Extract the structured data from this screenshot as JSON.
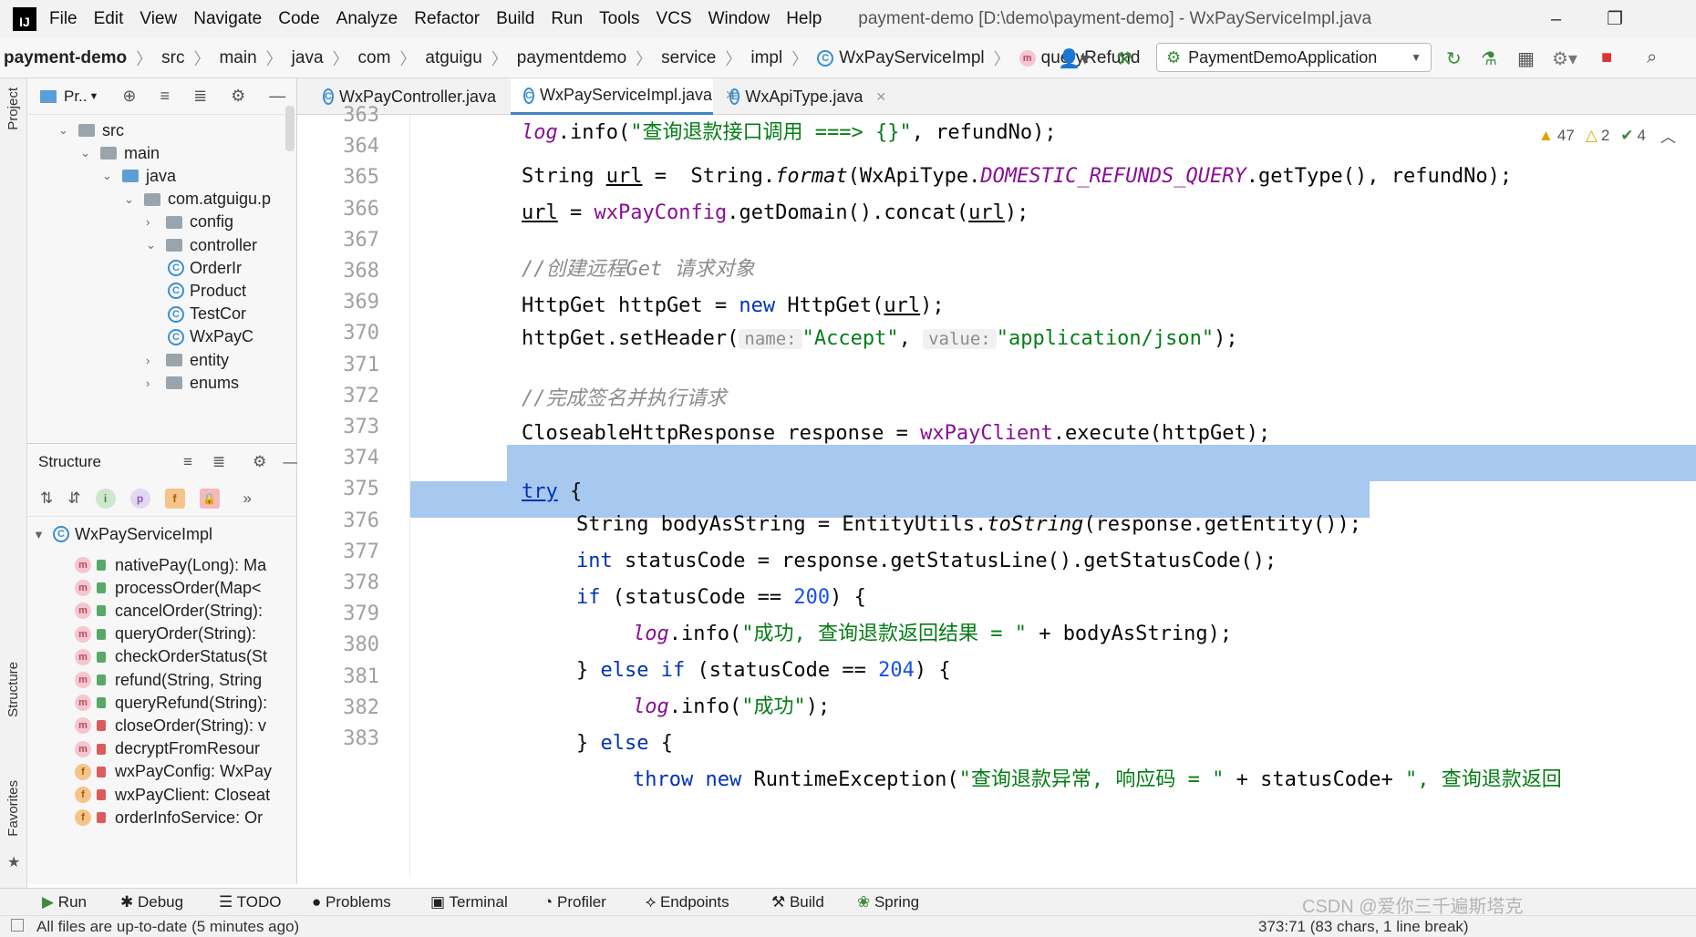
{
  "menu": {
    "logo": "IJ",
    "items": [
      "File",
      "Edit",
      "View",
      "Navigate",
      "Code",
      "Analyze",
      "Refactor",
      "Build",
      "Run",
      "Tools",
      "VCS",
      "Window",
      "Help"
    ],
    "window_title": "payment-demo [D:\\demo\\payment-demo] - WxPayServiceImpl.java"
  },
  "breadcrumb": {
    "project": "payment-demo",
    "items": [
      "src",
      "main",
      "java",
      "com",
      "atguigu",
      "paymentdemo",
      "service",
      "impl"
    ],
    "class": "WxPayServiceImpl",
    "method": "queryRefund"
  },
  "run_config": {
    "label": "PaymentDemoApplication"
  },
  "project_panel": {
    "title": "Pr..",
    "tree": [
      {
        "label": "src",
        "depth": 1,
        "kind": "folder",
        "expanded": true
      },
      {
        "label": "main",
        "depth": 2,
        "kind": "folder",
        "expanded": true
      },
      {
        "label": "java",
        "depth": 3,
        "kind": "folder-blue",
        "expanded": true
      },
      {
        "label": "com.atguigu.p",
        "depth": 4,
        "kind": "folder",
        "expanded": true
      },
      {
        "label": "config",
        "depth": 5,
        "kind": "folder",
        "expanded": false
      },
      {
        "label": "controller",
        "depth": 5,
        "kind": "folder",
        "expanded": true
      },
      {
        "label": "OrderIr",
        "depth": 6,
        "kind": "class"
      },
      {
        "label": "Product",
        "depth": 6,
        "kind": "class"
      },
      {
        "label": "TestCor",
        "depth": 6,
        "kind": "class"
      },
      {
        "label": "WxPayC",
        "depth": 6,
        "kind": "class"
      },
      {
        "label": "entity",
        "depth": 5,
        "kind": "folder",
        "expanded": false
      },
      {
        "label": "enums",
        "depth": 5,
        "kind": "folder",
        "expanded": false
      }
    ]
  },
  "structure_panel": {
    "title": "Structure",
    "root": "WxPayServiceImpl",
    "members": [
      {
        "label": "nativePay(Long): Ma",
        "type": "m",
        "access": "public"
      },
      {
        "label": "processOrder(Map<",
        "type": "m",
        "access": "public"
      },
      {
        "label": "cancelOrder(String):",
        "type": "m",
        "access": "public"
      },
      {
        "label": "queryOrder(String):",
        "type": "m",
        "access": "public"
      },
      {
        "label": "checkOrderStatus(St",
        "type": "m",
        "access": "public"
      },
      {
        "label": "refund(String, String",
        "type": "m",
        "access": "public"
      },
      {
        "label": "queryRefund(String):",
        "type": "m",
        "access": "public"
      },
      {
        "label": "closeOrder(String): v",
        "type": "m",
        "access": "private"
      },
      {
        "label": "decryptFromResour",
        "type": "m",
        "access": "private"
      },
      {
        "label": "wxPayConfig: WxPay",
        "type": "f",
        "access": "private"
      },
      {
        "label": "wxPayClient: Closeat",
        "type": "f",
        "access": "private"
      },
      {
        "label": "orderInfoService: Or",
        "type": "f",
        "access": "private"
      }
    ]
  },
  "editor_tabs": [
    {
      "label": "WxPayController.java",
      "icon": "C",
      "active": false
    },
    {
      "label": "WxPayServiceImpl.java",
      "icon": "C",
      "active": true
    },
    {
      "label": "WxApiType.java",
      "icon": "E",
      "active": false
    }
  ],
  "inspections": {
    "warnings": "47",
    "weak_warnings": "2",
    "typos": "4"
  },
  "code": {
    "line_numbers": [
      "363",
      "364",
      "365",
      "366",
      "367",
      "368",
      "369",
      "370",
      "371",
      "372",
      "373",
      "374",
      "375",
      "376",
      "377",
      "378",
      "379",
      "380",
      "381",
      "382",
      "383"
    ],
    "l363": {
      "a": "log",
      "b": ".info(",
      "c": "\"查询退款接口调用 ===> {}\"",
      "d": ", refundNo);"
    },
    "l365": {
      "a": "String ",
      "b": "url",
      "c": " =  String.",
      "d": "format",
      "e": "(WxApiType.",
      "f": "DOMESTIC_REFUNDS_QUERY",
      "g": ".getType(), refundNo);"
    },
    "l366": {
      "a": "url",
      "b": " = ",
      "c": "wxPayConfig",
      "d": ".getDomain().concat(",
      "e": "url",
      "f": ");"
    },
    "l368": {
      "a": "//创建远程Get 请求对象"
    },
    "l369": {
      "a": "HttpGet httpGet = ",
      "b": "new",
      "c": " HttpGet(",
      "d": "url",
      "e": ");"
    },
    "l370": {
      "a": "httpGet.setHeader(",
      "b": "name:",
      "c": "\"Accept\"",
      "d": ", ",
      "e": "value:",
      "f": "\"application/json\"",
      "g": ");"
    },
    "l372": {
      "a": "//完成签名并执行请求"
    },
    "l373": {
      "a": "CloseableHttpResponse response = ",
      "b": "wxPayClient",
      ".c": "",
      "c": ".execute(httpGet);"
    },
    "l375": {
      "a": "try",
      "b": " {"
    },
    "l376": {
      "a": "String bodyAsString = EntityUtils.",
      "b": "toString",
      "c": "(response.getEntity());"
    },
    "l377": {
      "a": "int",
      "b": " statusCode = response.getStatusLine().getStatusCode();"
    },
    "l378": {
      "a": "if",
      "b": " (statusCode == ",
      "c": "200",
      "d": ") {"
    },
    "l379": {
      "a": "log",
      "b": ".info(",
      "c": "\"成功, 查询退款返回结果 = \"",
      "d": " + bodyAsString);"
    },
    "l380": {
      "a": "} ",
      "b": "else if",
      "c": " (statusCode == ",
      "d": "204",
      "e": ") {"
    },
    "l381": {
      "a": "log",
      "b": ".info(",
      "c": "\"成功\"",
      "d": ");"
    },
    "l382": {
      "a": "} ",
      "b": "else",
      "c": " {"
    },
    "l383": {
      "a": "throw new",
      "b": " RuntimeException(",
      "c": "\"查询退款异常, 响应码 = \"",
      "d": " + statusCode+ ",
      "e": "\", 查询退款返回"
    }
  },
  "bottom_tools": [
    "Run",
    "Debug",
    "TODO",
    "Problems",
    "Terminal",
    "Profiler",
    "Endpoints",
    "Build",
    "Spring"
  ],
  "status": {
    "message": "All files are up-to-date (5 minutes ago)",
    "position": "373:71 (83 chars, 1 line break)",
    "watermark": "CSDN @爱你三千遍斯塔克"
  },
  "side_labels": {
    "project": "Project",
    "structure": "Structure",
    "favorites": "Favorites"
  },
  "colors": {
    "selection": "#a7c8ef",
    "keyword": "#0033b3",
    "string": "#067d17",
    "field": "#871094",
    "arrow": "#e8262d"
  }
}
